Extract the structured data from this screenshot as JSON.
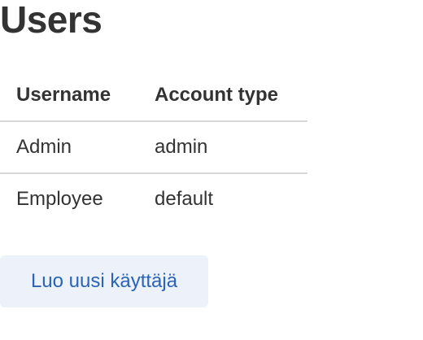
{
  "page": {
    "title": "Users"
  },
  "table": {
    "headers": [
      "Username",
      "Account type"
    ],
    "rows": [
      {
        "username": "Admin",
        "account_type": "admin"
      },
      {
        "username": "Employee",
        "account_type": "default"
      }
    ]
  },
  "actions": {
    "create_user_label": "Luo uusi käyttäjä"
  },
  "colors": {
    "text": "#333333",
    "divider": "#d8d8d8",
    "button_bg": "#edf2fa",
    "button_text": "#2a63b8"
  }
}
